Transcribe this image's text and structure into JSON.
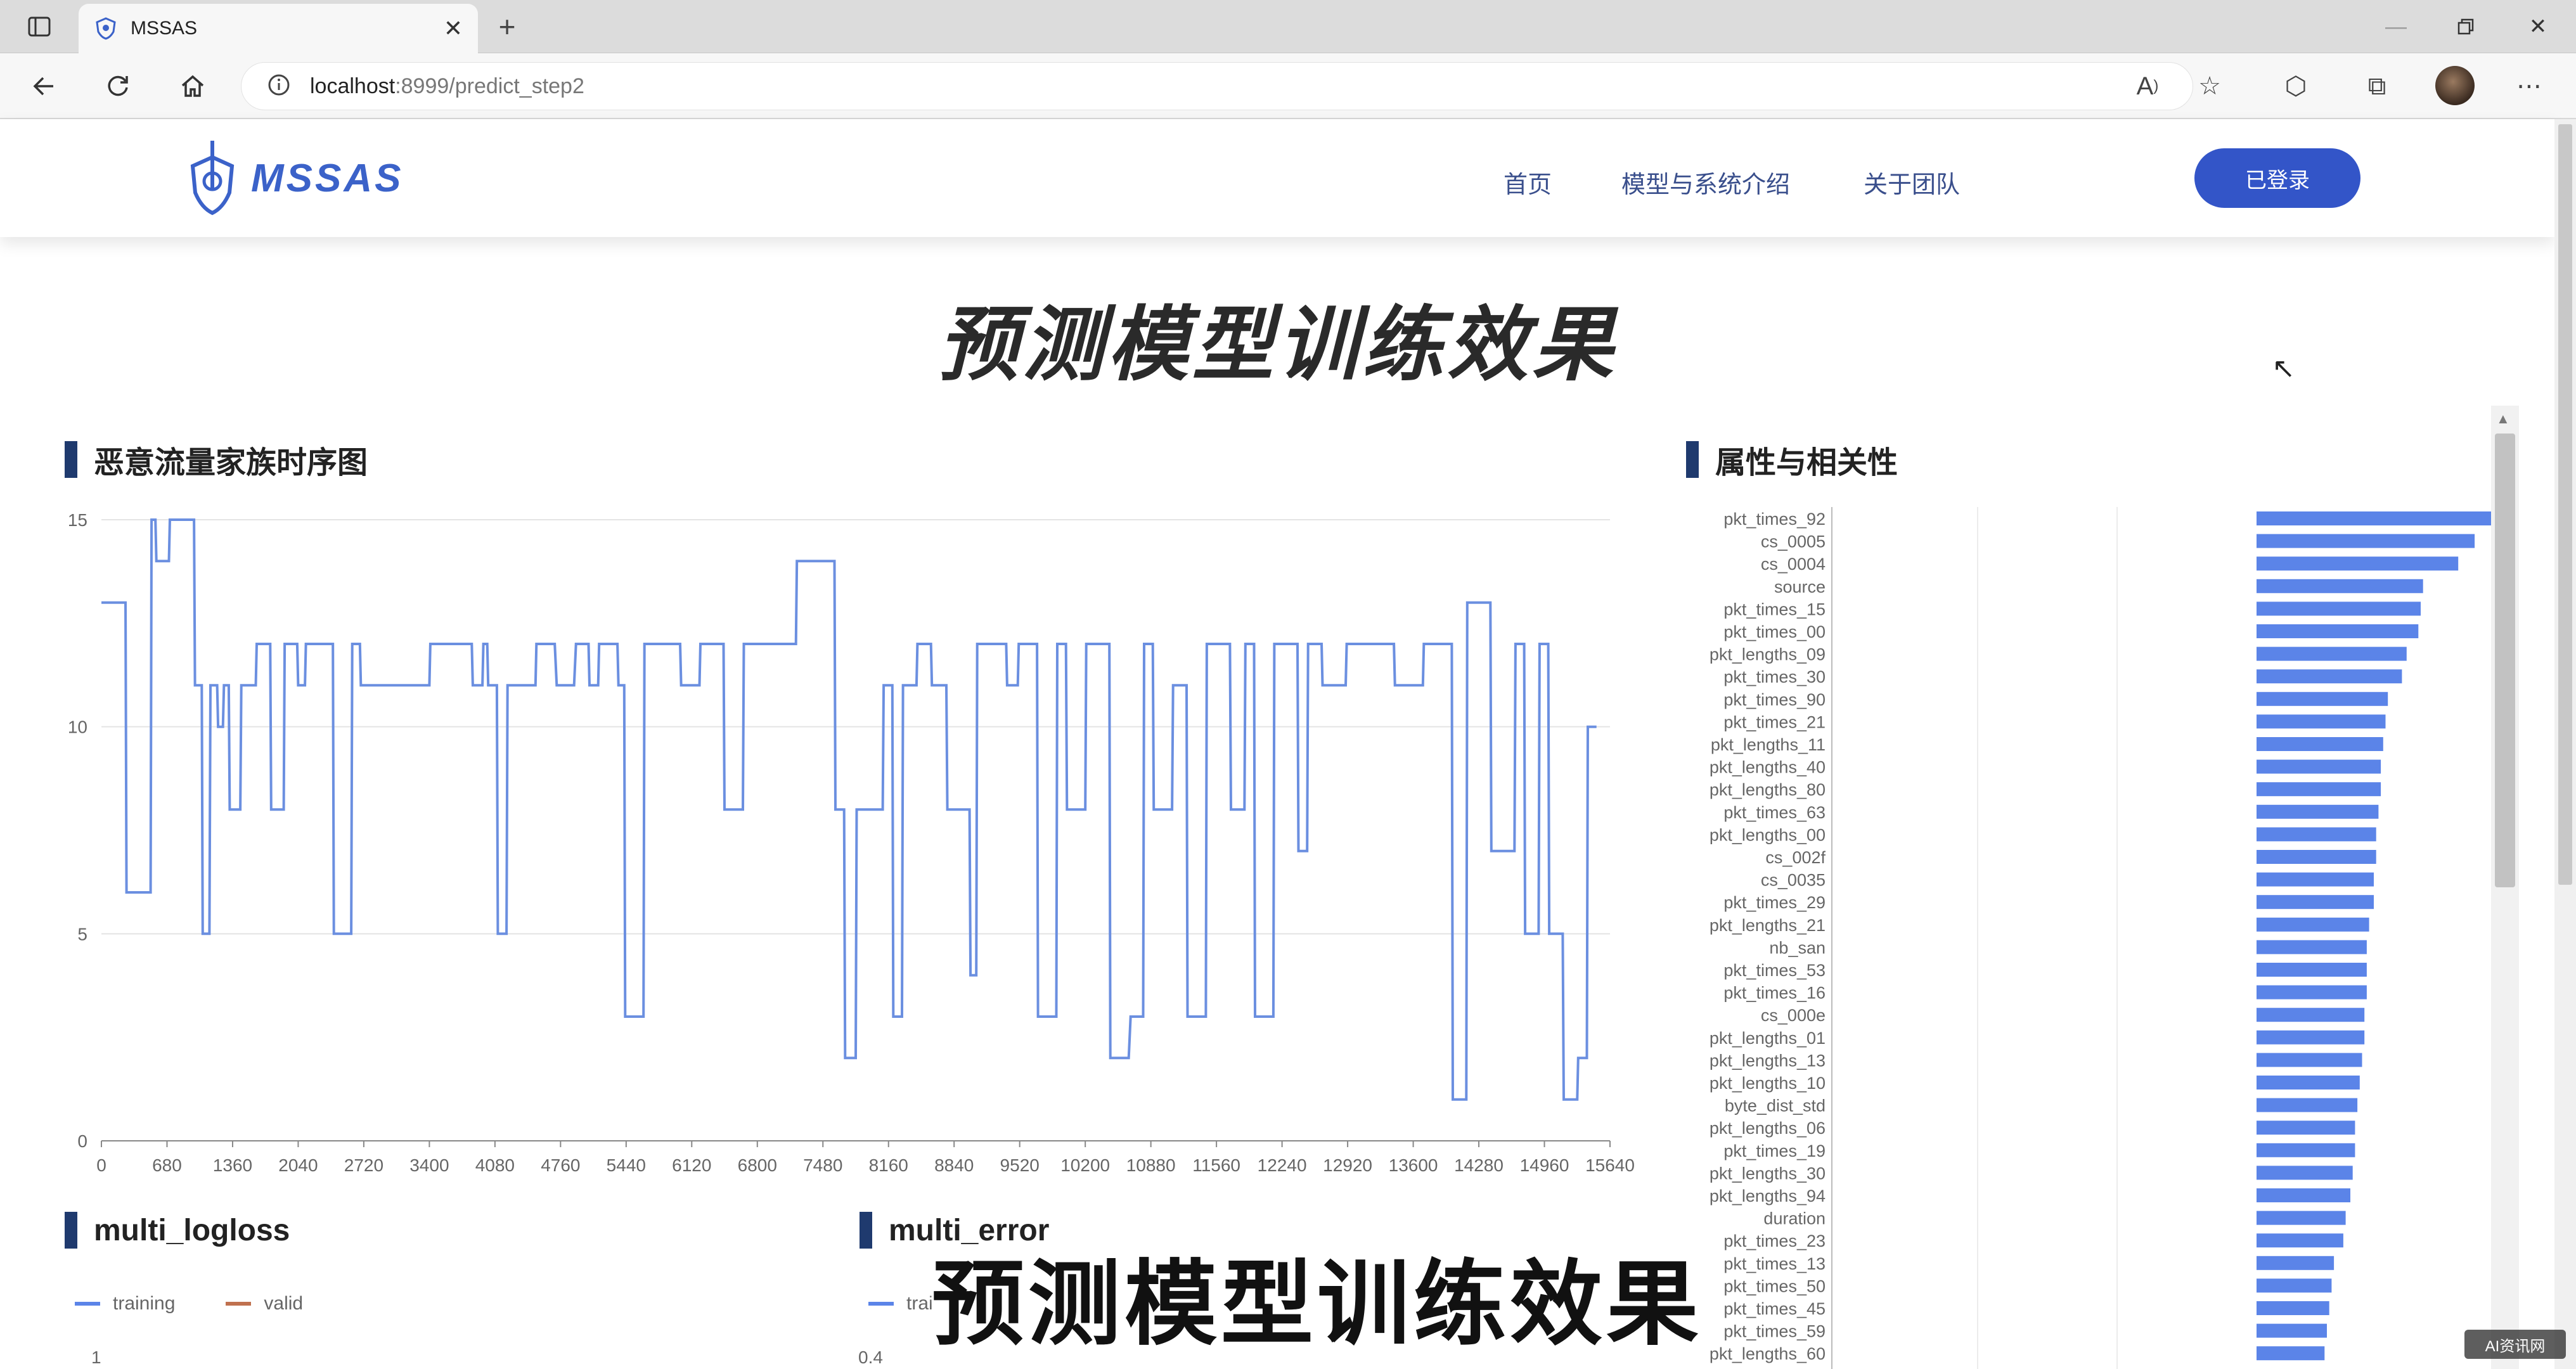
{
  "browser": {
    "tab_title": "MSSAS",
    "url_host": "localhost",
    "url_rest": ":8999/predict_step2"
  },
  "site": {
    "logo_text": "MSSAS",
    "nav": [
      "首页",
      "模型与系统介绍",
      "关于团队"
    ],
    "login_label": "已登录"
  },
  "page_title": "预测模型训练效果",
  "overlay_caption": "预测模型训练效果",
  "watermark": "AI资讯网",
  "colors": {
    "line": "#6b8fe0",
    "bar": "#5b84e8",
    "accent": "#3355c8",
    "section_bar": "#1f3a6e",
    "valid": "#c0714f"
  },
  "sections": {
    "timeseries_title": "恶意流量家族时序图",
    "importance_title": "属性与相关性",
    "logloss_title": "multi_logloss",
    "error_title": "multi_error"
  },
  "logloss_legend": {
    "training": "training",
    "valid": "valid"
  },
  "error_legend": {
    "training": "trai"
  },
  "logloss_axis_top": "1",
  "error_axis_top": "0.4",
  "chart_data": [
    {
      "type": "line",
      "title": "恶意流量家族时序图",
      "xlabel": "",
      "ylabel": "",
      "ylim": [
        0,
        15
      ],
      "yticks": [
        0,
        5,
        10,
        15
      ],
      "xlim": [
        0,
        15640
      ],
      "xticks": [
        0,
        680,
        1360,
        2040,
        2720,
        3400,
        4080,
        4760,
        5440,
        6120,
        6800,
        7480,
        8160,
        8840,
        9520,
        10200,
        10880,
        11560,
        12240,
        12920,
        13600,
        14280,
        14960,
        15640
      ],
      "grid": true,
      "step": true,
      "x": [
        0,
        250,
        260,
        510,
        520,
        560,
        570,
        700,
        710,
        960,
        970,
        1040,
        1050,
        1120,
        1130,
        1200,
        1210,
        1260,
        1270,
        1320,
        1330,
        1440,
        1450,
        1600,
        1610,
        1750,
        1760,
        1890,
        1900,
        2030,
        2040,
        2110,
        2120,
        2400,
        2410,
        2590,
        2600,
        2680,
        2690,
        3400,
        3410,
        3840,
        3850,
        3950,
        3960,
        4000,
        4010,
        4100,
        4110,
        4200,
        4210,
        4500,
        4510,
        4700,
        4720,
        4900,
        4920,
        5050,
        5060,
        5150,
        5160,
        5350,
        5360,
        5420,
        5430,
        5620,
        5630,
        6000,
        6010,
        6200,
        6210,
        6450,
        6460,
        6650,
        6660,
        7200,
        7210,
        7600,
        7610,
        7700,
        7710,
        7820,
        7830,
        8100,
        8110,
        8200,
        8210,
        8300,
        8310,
        8450,
        8460,
        8600,
        8610,
        8760,
        8770,
        9000,
        9010,
        9070,
        9080,
        9380,
        9390,
        9500,
        9510,
        9700,
        9710,
        9900,
        9910,
        10000,
        10010,
        10200,
        10210,
        10450,
        10460,
        10650,
        10670,
        10800,
        10810,
        10900,
        10910,
        11100,
        11110,
        11250,
        11260,
        11450,
        11460,
        11700,
        11710,
        11850,
        11860,
        11950,
        11960,
        12150,
        12160,
        12400,
        12410,
        12500,
        12510,
        12650,
        12660,
        12900,
        12910,
        13400,
        13410,
        13700,
        13710,
        14000,
        14010,
        14150,
        14160,
        14400,
        14410,
        14650,
        14660,
        14750,
        14760,
        14900,
        14910,
        15000,
        15010,
        15150,
        15160,
        15300,
        15310,
        15400,
        15410,
        15500,
        15510,
        15560,
        15570,
        15640
      ],
      "y": [
        13,
        13,
        6,
        6,
        15,
        15,
        14,
        14,
        15,
        15,
        11,
        11,
        5,
        5,
        11,
        11,
        10,
        10,
        11,
        11,
        8,
        8,
        11,
        11,
        12,
        12,
        8,
        8,
        12,
        12,
        11,
        11,
        12,
        12,
        5,
        5,
        12,
        12,
        11,
        11,
        12,
        12,
        11,
        11,
        12,
        12,
        11,
        11,
        5,
        5,
        11,
        11,
        12,
        12,
        11,
        11,
        12,
        12,
        11,
        11,
        12,
        12,
        11,
        11,
        3,
        3,
        12,
        12,
        11,
        11,
        12,
        12,
        8,
        8,
        12,
        12,
        14,
        14,
        8,
        8,
        2,
        2,
        8,
        8,
        11,
        11,
        3,
        3,
        11,
        11,
        12,
        12,
        11,
        11,
        8,
        8,
        4,
        4,
        12,
        12,
        11,
        11,
        12,
        12,
        3,
        3,
        12,
        12,
        8,
        8,
        12,
        12,
        2,
        2,
        3,
        3,
        12,
        12,
        8,
        8,
        11,
        11,
        3,
        3,
        12,
        12,
        8,
        8,
        12,
        12,
        3,
        3,
        12,
        12,
        7,
        7,
        12,
        12,
        11,
        11,
        12,
        12,
        11,
        11,
        12,
        12,
        1,
        1,
        13,
        13,
        7,
        7,
        12,
        12,
        5,
        5,
        12,
        12,
        5,
        5,
        1,
        1,
        2,
        2,
        10,
        10
      ]
    },
    {
      "type": "bar",
      "orientation": "horizontal",
      "title": "属性与相关性",
      "categories": [
        "pkt_times_92",
        "cs_0005",
        "cs_0004",
        "source",
        "pkt_times_15",
        "pkt_times_00",
        "pkt_lengths_09",
        "pkt_times_30",
        "pkt_times_90",
        "pkt_times_21",
        "pkt_lengths_11",
        "pkt_lengths_40",
        "pkt_lengths_80",
        "pkt_times_63",
        "pkt_lengths_00",
        "cs_002f",
        "cs_0035",
        "pkt_times_29",
        "pkt_lengths_21",
        "nb_san",
        "pkt_times_53",
        "pkt_times_16",
        "cs_000e",
        "pkt_lengths_01",
        "pkt_lengths_13",
        "pkt_lengths_10",
        "byte_dist_std",
        "pkt_lengths_06",
        "pkt_times_19",
        "pkt_lengths_30",
        "pkt_lengths_94",
        "duration",
        "pkt_times_23",
        "pkt_times_13",
        "pkt_times_50",
        "pkt_times_45",
        "pkt_times_59",
        "pkt_lengths_60"
      ],
      "values": [
        1.0,
        0.93,
        0.86,
        0.71,
        0.7,
        0.69,
        0.64,
        0.62,
        0.56,
        0.55,
        0.54,
        0.53,
        0.53,
        0.52,
        0.51,
        0.51,
        0.5,
        0.5,
        0.48,
        0.47,
        0.47,
        0.47,
        0.46,
        0.46,
        0.45,
        0.44,
        0.43,
        0.42,
        0.42,
        0.41,
        0.4,
        0.38,
        0.37,
        0.33,
        0.32,
        0.31,
        0.3,
        0.29
      ],
      "xlim": [
        0,
        1
      ],
      "grid": true
    }
  ]
}
